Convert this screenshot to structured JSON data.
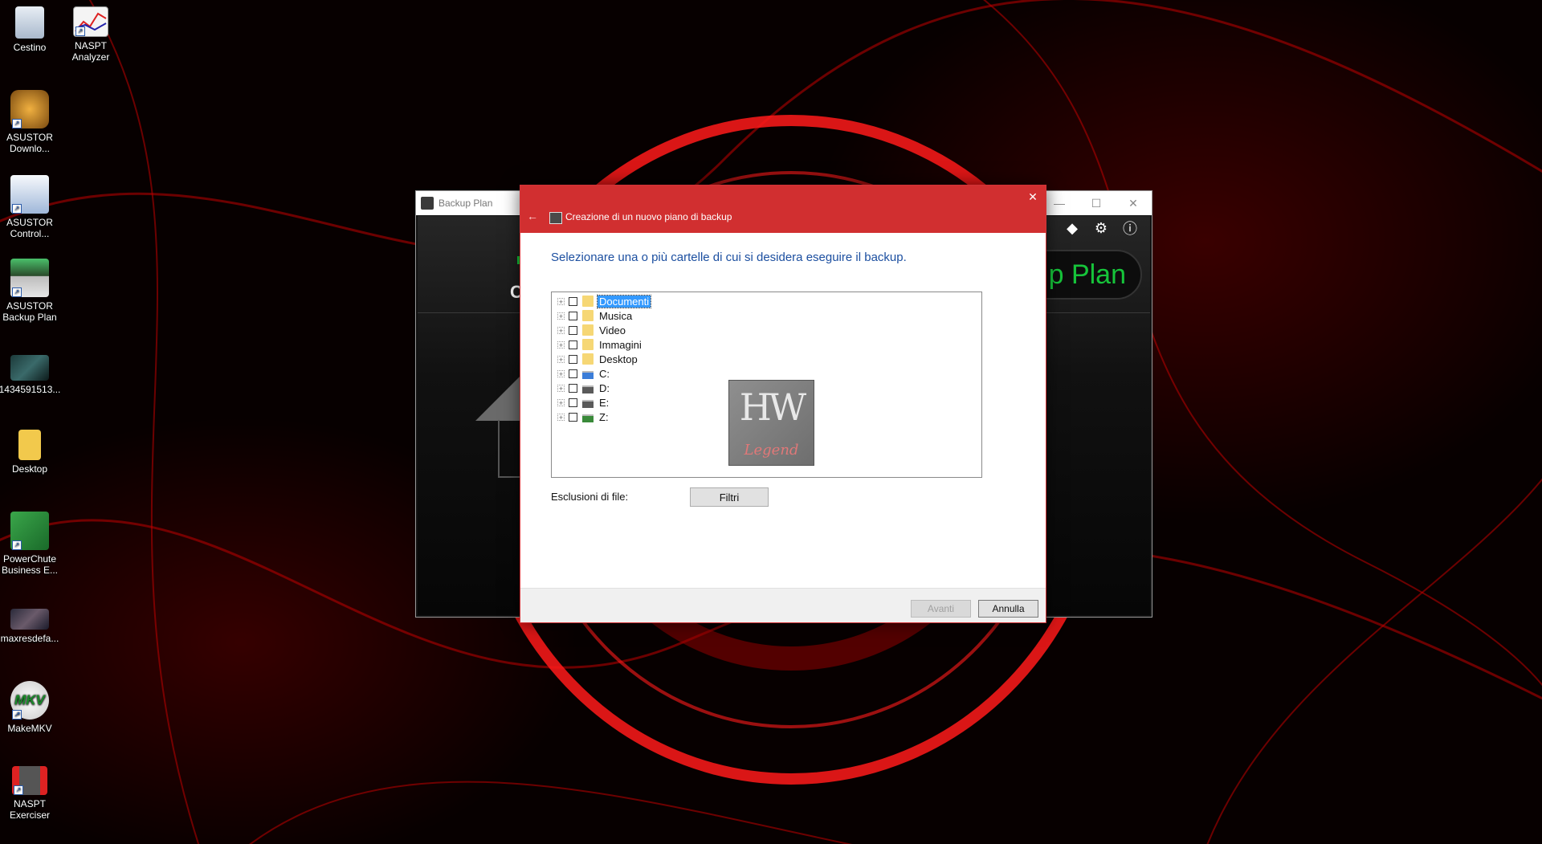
{
  "desktop": {
    "icons": [
      {
        "label": "Cestino",
        "icon": "recycle-bin-icon"
      },
      {
        "label": "NASPT Analyzer",
        "icon": "chart-app-icon"
      },
      {
        "label": "ASUSTOR Downlo...",
        "icon": "download-app-icon"
      },
      {
        "label": "ASUSTOR Control...",
        "icon": "control-center-icon"
      },
      {
        "label": "ASUSTOR Backup Plan",
        "icon": "backup-plan-icon"
      },
      {
        "label": "1434591513...",
        "icon": "image-file-icon"
      },
      {
        "label": "Desktop",
        "icon": "folder-icon"
      },
      {
        "label": "PowerChute Business E...",
        "icon": "powerchute-icon"
      },
      {
        "label": "maxresdefa...",
        "icon": "image-file-icon"
      },
      {
        "label": "MakeMKV",
        "icon": "makemkv-icon"
      },
      {
        "label": "NASPT Exerciser",
        "icon": "exerciser-icon"
      }
    ]
  },
  "background_window": {
    "title": "Backup Plan",
    "brand_text": "p Plan",
    "left_fragment": "C"
  },
  "dialog": {
    "title": "Creazione di un nuovo piano di backup",
    "instruction": "Selezionare una o più cartelle di cui si desidera eseguire il backup.",
    "tree": [
      {
        "label": "Documenti",
        "kind": "folder",
        "selected": true
      },
      {
        "label": "Musica",
        "kind": "folder"
      },
      {
        "label": "Video",
        "kind": "folder"
      },
      {
        "label": "Immagini",
        "kind": "folder"
      },
      {
        "label": "Desktop",
        "kind": "folder"
      },
      {
        "label": "C:",
        "kind": "drive-system"
      },
      {
        "label": "D:",
        "kind": "drive"
      },
      {
        "label": "E:",
        "kind": "drive"
      },
      {
        "label": "Z:",
        "kind": "drive-network"
      }
    ],
    "watermark": {
      "top": "HW",
      "bottom": "Legend"
    },
    "exclusions_label": "Esclusioni di file:",
    "filters_button": "Filtri",
    "next_button": "Avanti",
    "cancel_button": "Annulla"
  },
  "colors": {
    "dialog_title_bg": "#d12f30",
    "instruction_text": "#1c4fa0",
    "selection": "#3399ff",
    "brand_green": "#16c43a"
  }
}
